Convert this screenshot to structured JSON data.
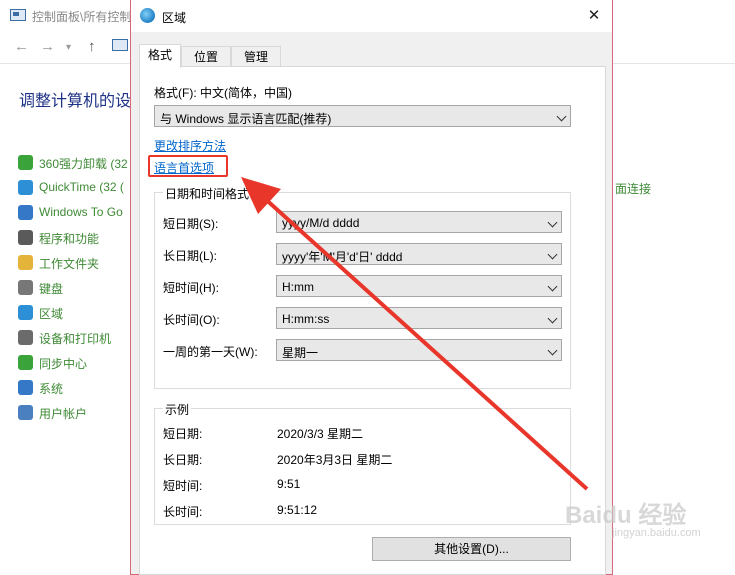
{
  "background_window": {
    "title": "控制面板\\所有控制",
    "heading": "调整计算机的设",
    "items": [
      {
        "label": "360强力卸载 (32",
        "icon": "uninstall-icon",
        "color": "#3aa33a"
      },
      {
        "label": "QuickTime (32 (",
        "icon": "quicktime-icon",
        "color": "#2d8fd5"
      },
      {
        "label": "Windows To Go",
        "icon": "windows-to-go-icon",
        "color": "#3578c7"
      },
      {
        "label": "程序和功能",
        "icon": "programs-icon",
        "color": "#5a5a5a"
      },
      {
        "label": "工作文件夹",
        "icon": "work-folders-icon",
        "color": "#e3b33a"
      },
      {
        "label": "键盘",
        "icon": "keyboard-icon",
        "color": "#777777"
      },
      {
        "label": "区域",
        "icon": "region-icon",
        "color": "#2d8fd5"
      },
      {
        "label": "设备和打印机",
        "icon": "devices-printers-icon",
        "color": "#6b6b6b"
      },
      {
        "label": "同步中心",
        "icon": "sync-center-icon",
        "color": "#3aa33a"
      },
      {
        "label": "系统",
        "icon": "system-icon",
        "color": "#3578c7"
      },
      {
        "label": "用户帐户",
        "icon": "user-accounts-icon",
        "color": "#4a7fc0"
      }
    ],
    "right_link": "面连接"
  },
  "dialog": {
    "title": "区域",
    "close_glyph": "✕",
    "tabs": [
      {
        "label": "格式",
        "active": true
      },
      {
        "label": "位置",
        "active": false
      },
      {
        "label": "管理",
        "active": false
      }
    ],
    "format_label": "格式(F): 中文(简体，中国)",
    "format_value": "与 Windows 显示语言匹配(推荐)",
    "links": {
      "sort": "更改排序方法",
      "language_prefs": "语言首选项"
    },
    "datetime_group": {
      "title": "日期和时间格式",
      "rows": [
        {
          "label": "短日期(S):",
          "value": "yyyy/M/d dddd"
        },
        {
          "label": "长日期(L):",
          "value": "yyyy'年'M'月'd'日' dddd"
        },
        {
          "label": "短时间(H):",
          "value": "H:mm"
        },
        {
          "label": "长时间(O):",
          "value": "H:mm:ss"
        },
        {
          "label": "一周的第一天(W):",
          "value": "星期一"
        }
      ]
    },
    "examples_group": {
      "title": "示例",
      "rows": [
        {
          "label": "短日期:",
          "value": "2020/3/3 星期二"
        },
        {
          "label": "长日期:",
          "value": "2020年3月3日 星期二"
        },
        {
          "label": "短时间:",
          "value": "9:51"
        },
        {
          "label": "长时间:",
          "value": "9:51:12"
        }
      ]
    },
    "other_settings": "其他设置(D)..."
  },
  "watermark": {
    "main": "Baidu 经验",
    "sub": "jingyan.baidu.com"
  },
  "colors": {
    "annotation": "#e8362b",
    "link": "#0066cc",
    "cp_item": "#3f8a36"
  }
}
